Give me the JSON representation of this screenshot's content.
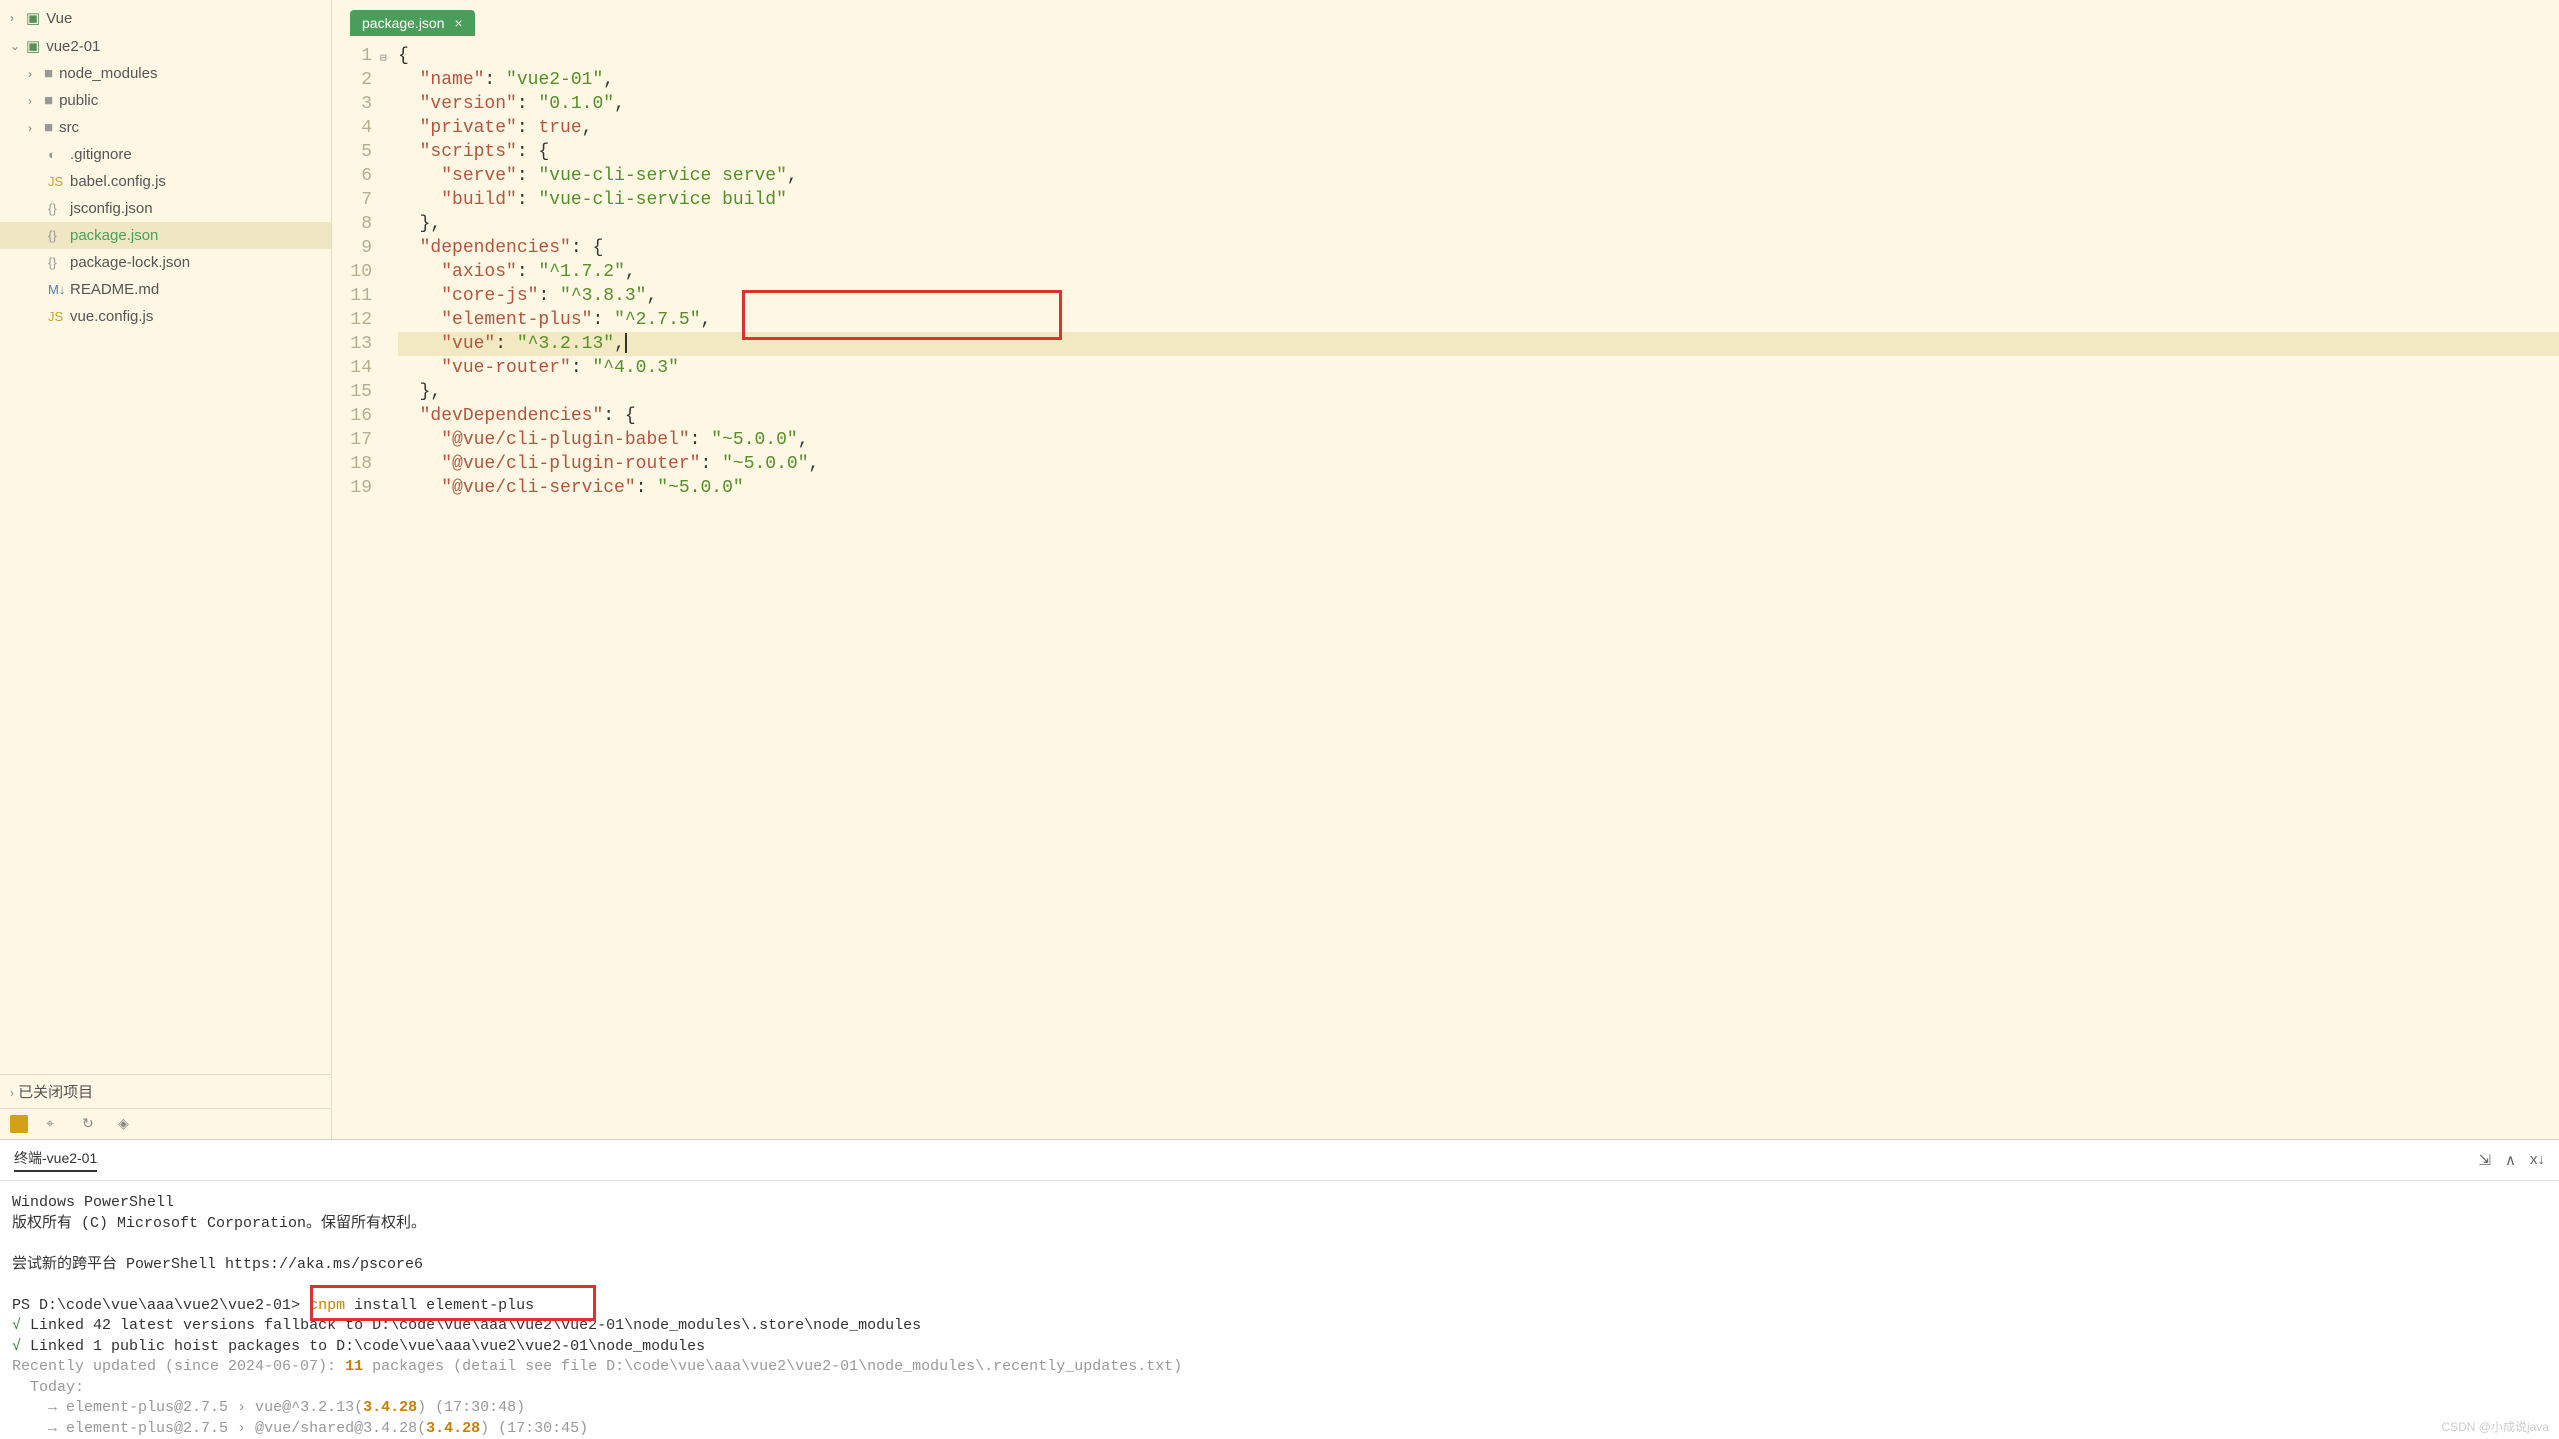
{
  "sidebar": {
    "projects": [
      {
        "name": "Vue",
        "expanded": false
      },
      {
        "name": "vue2-01",
        "expanded": true,
        "children": [
          {
            "name": "node_modules",
            "type": "folder"
          },
          {
            "name": "public",
            "type": "folder"
          },
          {
            "name": "src",
            "type": "folder"
          },
          {
            "name": ".gitignore",
            "type": "file",
            "icon": "git"
          },
          {
            "name": "babel.config.js",
            "type": "file",
            "icon": "js"
          },
          {
            "name": "jsconfig.json",
            "type": "file",
            "icon": "json"
          },
          {
            "name": "package.json",
            "type": "file",
            "icon": "json",
            "active": true
          },
          {
            "name": "package-lock.json",
            "type": "file",
            "icon": "json"
          },
          {
            "name": "README.md",
            "type": "file",
            "icon": "md"
          },
          {
            "name": "vue.config.js",
            "type": "file",
            "icon": "js"
          }
        ]
      }
    ],
    "closed_label": "已关闭项目"
  },
  "editor": {
    "tab_name": "package.json",
    "json_content": {
      "name": "vue2-01",
      "version": "0.1.0",
      "private": true,
      "scripts": {
        "serve": "vue-cli-service serve",
        "build": "vue-cli-service build"
      },
      "dependencies": {
        "axios": "^1.7.2",
        "core-js": "^3.8.3",
        "element-plus": "^2.7.5",
        "vue": "^3.2.13",
        "vue-router": "^4.0.3"
      },
      "devDependencies": {
        "@vue/cli-plugin-babel": "~5.0.0",
        "@vue/cli-plugin-router": "~5.0.0",
        "@vue/cli-service": "~5.0.0"
      }
    }
  },
  "terminal": {
    "title": "终端-vue2-01",
    "header_lines": [
      "Windows PowerShell",
      "版权所有 (C) Microsoft Corporation。保留所有权利。",
      "",
      "尝试新的跨平台 PowerShell https://aka.ms/pscore6",
      ""
    ],
    "prompt": "PS D:\\code\\vue\\aaa\\vue2\\vue2-01>",
    "command_cnpm": "cnpm",
    "command_rest": " install element-plus",
    "output": [
      {
        "check": true,
        "text": "Linked 42 latest versions fallback to D:\\code\\vue\\aaa\\vue2\\vue2-01\\node_modules\\.store\\node_modules"
      },
      {
        "check": true,
        "text": "Linked 1 public hoist packages to D:\\code\\vue\\aaa\\vue2\\vue2-01\\node_modules"
      }
    ],
    "recently": {
      "prefix": "Recently updated (since 2024-06-07): ",
      "count": "11",
      "suffix": " packages (detail see file D:\\code\\vue\\aaa\\vue2\\vue2-01\\node_modules\\.recently_updates.txt)"
    },
    "today_label": "  Today:",
    "updates": [
      {
        "pkg": "element-plus@2.7.5 › vue@^3.2.13(",
        "ver": "3.4.28",
        "time": ") (17:30:48)"
      },
      {
        "pkg": "element-plus@2.7.5 › @vue/shared@3.4.28(",
        "ver": "3.4.28",
        "time": ") (17:30:45)"
      }
    ]
  },
  "watermark": "CSDN @小成说java"
}
